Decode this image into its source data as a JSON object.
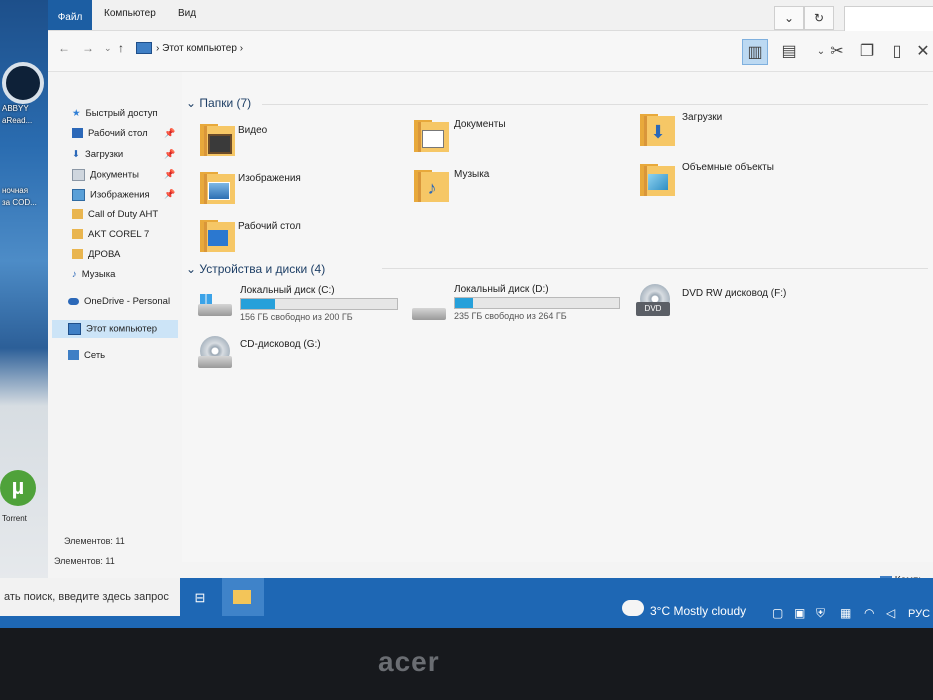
{
  "ribbon": {
    "tab_file": "Файл",
    "tab_computer": "Компьютер",
    "tab_view": "Вид",
    "expand_icon": "chevron-down-icon",
    "refresh_icon": "refresh-icon"
  },
  "address": {
    "breadcrumb": "Этот компьютер",
    "sep": "›"
  },
  "nav_pane": {
    "items": [
      {
        "label": "Быстрый доступ",
        "icon": "star-icon",
        "pinned": false
      },
      {
        "label": "Рабочий стол",
        "icon": "desktop-icon",
        "pinned": true
      },
      {
        "label": "Загрузки",
        "icon": "download-icon",
        "pinned": true
      },
      {
        "label": "Документы",
        "icon": "documents-icon",
        "pinned": true
      },
      {
        "label": "Изображения",
        "icon": "pictures-icon",
        "pinned": true
      },
      {
        "label": "Call of Duty AHT",
        "icon": "folder-icon",
        "pinned": false
      },
      {
        "label": "AKT COREL 7",
        "icon": "folder-icon",
        "pinned": false
      },
      {
        "label": "ДРОВА",
        "icon": "folder-icon",
        "pinned": false
      },
      {
        "label": "Музыка",
        "icon": "music-icon",
        "pinned": false
      },
      {
        "label": "OneDrive - Personal",
        "icon": "cloud-icon",
        "pinned": false
      },
      {
        "label": "Этот компьютер",
        "icon": "computer-icon",
        "pinned": false
      },
      {
        "label": "Сеть",
        "icon": "network-icon",
        "pinned": false
      }
    ],
    "status_inner": "Элементов: 11",
    "status_outer": "Элементов: 11"
  },
  "content": {
    "folders_header": "Папки (7)",
    "folders": [
      {
        "label": "Видео",
        "badge": "video"
      },
      {
        "label": "Документы",
        "badge": "docs"
      },
      {
        "label": "Загрузки",
        "badge": "download"
      },
      {
        "label": "Изображения",
        "badge": "pictures"
      },
      {
        "label": "Музыка",
        "badge": "music"
      },
      {
        "label": "Объемные объекты",
        "badge": "3d"
      },
      {
        "label": "Рабочий стол",
        "badge": "desktop"
      }
    ],
    "devices_header": "Устройства и диски (4)",
    "drives": [
      {
        "label": "Локальный диск (C:)",
        "free": "156 ГБ свободно из 200 ГБ",
        "used_fraction": 0.22
      },
      {
        "label": "Локальный диск (D:)",
        "free": "235 ГБ свободно из 264 ГБ",
        "used_fraction": 0.11
      },
      {
        "label": "DVD RW дисковод (F:)"
      },
      {
        "label": "CD-дисковод (G:)"
      }
    ],
    "dvd_badge": "DVD"
  },
  "taskbar": {
    "search_placeholder": "ать поиск, введите здесь запрос",
    "weather": "3°C  Mostly cloudy",
    "lang": "РУС",
    "corner_status": "Компь"
  },
  "desktop": {
    "icon_labels": [
      "ABBYY",
      "aRead...",
      "ночная",
      "за COD...",
      "Torrent"
    ],
    "utorrent_glyph": "µ"
  },
  "bezel": {
    "brand": "acer"
  },
  "colors": {
    "accent": "#1c5ea3",
    "taskbar": "#1e67b4",
    "selection": "#cce4f7",
    "progress": "#26a0da"
  }
}
